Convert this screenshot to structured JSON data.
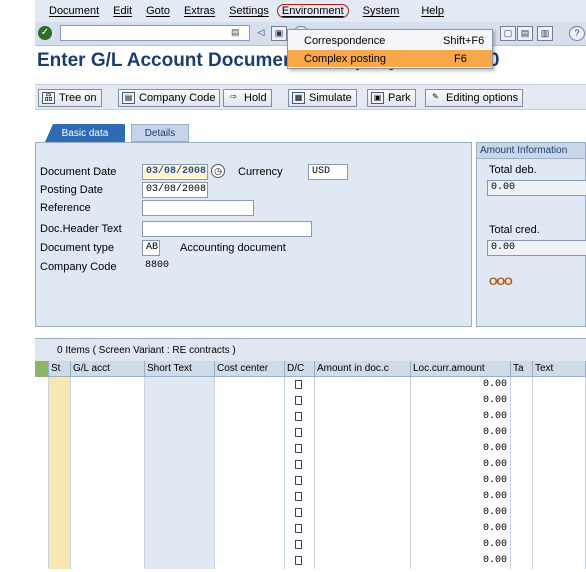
{
  "menu": [
    "Document",
    "Edit",
    "Goto",
    "Extras",
    "Settings",
    "Environment",
    "System",
    "Help"
  ],
  "dropdown": {
    "items": [
      {
        "label": "Correspondence",
        "shortcut": "Shift+F6"
      },
      {
        "label": "Complex posting",
        "shortcut": "F6"
      }
    ]
  },
  "page_title": "Enter G/L Account Document: Company Code 8800",
  "toolbar": {
    "tree_on": "Tree on",
    "company_code": "Company Code",
    "hold": "Hold",
    "simulate": "Simulate",
    "park": "Park",
    "editing_options": "Editing options"
  },
  "tabs": [
    "Basic data",
    "Details"
  ],
  "form": {
    "document_date_label": "Document Date",
    "document_date": "03/08/2008",
    "currency_label": "Currency",
    "currency": "USD",
    "posting_date_label": "Posting Date",
    "posting_date": "03/08/2008",
    "reference_label": "Reference",
    "reference": "",
    "doc_header_label": "Doc.Header Text",
    "doc_header": "",
    "doc_type_label": "Document type",
    "doc_type": "AB",
    "doc_type_desc": "Accounting document",
    "company_code_label": "Company Code",
    "company_code": "8800"
  },
  "amount_info": {
    "header": "Amount Information",
    "total_deb_label": "Total deb.",
    "total_deb": "0.00",
    "total_cred_label": "Total cred.",
    "total_cred": "0.00",
    "status_icon": "OOO"
  },
  "items_table": {
    "summary": "0 Items ( Screen Variant : RE contracts )",
    "headers": [
      "St",
      "G/L acct",
      "Short Text",
      "Cost center",
      "D/C",
      "Amount in doc.c",
      "Loc.curr.amount",
      "Ta",
      "Text"
    ],
    "rows": [
      "0.00",
      "0.00",
      "0.00",
      "0.00",
      "0.00",
      "0.00",
      "0.00",
      "0.00",
      "0.00",
      "0.00",
      "0.00",
      "0.00"
    ]
  }
}
